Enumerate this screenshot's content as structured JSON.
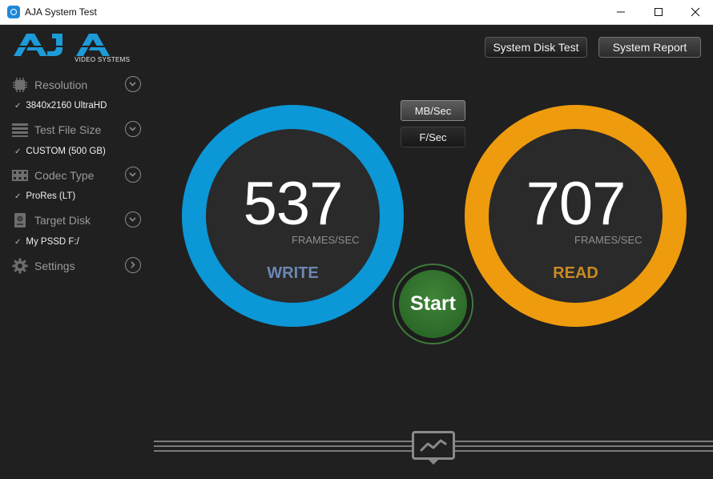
{
  "window": {
    "title": "AJA System Test"
  },
  "logo": {
    "subtitle": "VIDEO SYSTEMS"
  },
  "toolbar": {
    "system_disk_test": "System Disk Test",
    "system_report": "System Report"
  },
  "sidebar": {
    "items": [
      {
        "label": "Resolution",
        "icon": "chip-icon",
        "value": "3840x2160 UltraHD"
      },
      {
        "label": "Test File Size",
        "icon": "stack-icon",
        "value": "CUSTOM (500 GB)"
      },
      {
        "label": "Codec Type",
        "icon": "film-icon",
        "value": "ProRes (LT)"
      },
      {
        "label": "Target Disk",
        "icon": "disk-icon",
        "value": "My PSSD F:/"
      },
      {
        "label": "Settings",
        "icon": "gear-icon"
      }
    ],
    "check": "✓"
  },
  "units": {
    "mb_sec": "MB/Sec",
    "f_sec": "F/Sec",
    "selected": "MB/Sec"
  },
  "write": {
    "value": "537",
    "unit": "FRAMES/SEC",
    "label": "WRITE",
    "color": "#0c97d6",
    "label_color": "#6b87b3"
  },
  "read": {
    "value": "707",
    "unit": "FRAMES/SEC",
    "label": "READ",
    "color": "#ef9b0e",
    "label_color": "#c98a24"
  },
  "start": {
    "label": "Start",
    "color": "#2f6d2b"
  },
  "graph": {
    "icon": "graph-icon"
  }
}
